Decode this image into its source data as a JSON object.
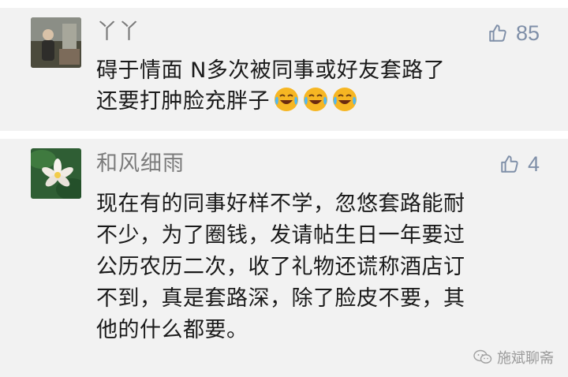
{
  "comments": [
    {
      "username": "丫丫",
      "likes": "85",
      "text": "碍于情面 N多次被同事或好友套路了\n还要打肿脸充胖子",
      "emojis": [
        "laugh-cry-icon",
        "laugh-cry-icon",
        "laugh-cry-icon"
      ]
    },
    {
      "username": "和风细雨",
      "likes": "4",
      "text": "现在有的同事好样不学，忽悠套路能耐\n不少，为了圈钱，发请帖生日一年要过\n公历农历二次，收了礼物还谎称酒店订\n不到，真是套路深，除了脸皮不要，其\n他的什么都要。"
    }
  ],
  "watermark": {
    "text": "施斌聊斋",
    "icon": "wechat-icon"
  },
  "colors": {
    "card_bg": "#f2f2f2",
    "username": "#7b7b7b",
    "like": "#7f8fa8",
    "text": "#1a1a1a"
  }
}
